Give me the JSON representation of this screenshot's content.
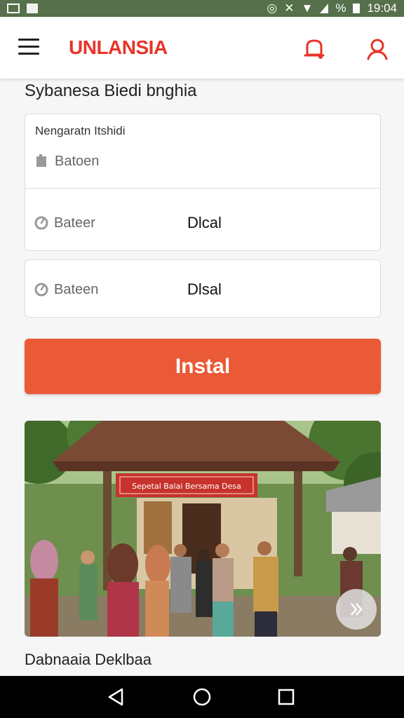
{
  "status_bar": {
    "time": "19:04",
    "battery_label": "%",
    "icons": [
      "image-icon",
      "alarm-icon",
      "vibrate-icon",
      "no-signal-icon",
      "wifi-icon",
      "signal-icon",
      "battery-icon"
    ]
  },
  "header": {
    "logo_text": "UNLANSIA",
    "accent_color": "#e8342a",
    "icons": [
      "menu-icon",
      "notification-bell-icon",
      "user-icon"
    ]
  },
  "page": {
    "title": "Sybanesa Biedi bnghia"
  },
  "form": {
    "field1": {
      "label": "Nengaratn Itshidi",
      "placeholder": "Batoen",
      "icon": "document-icon"
    },
    "field2": {
      "label": "Bateer",
      "value": "Dlcal",
      "icon": "clock-icon"
    },
    "field3": {
      "label": "Bateen",
      "value": "Dlsal",
      "icon": "clock-icon"
    }
  },
  "install_button": {
    "label": "Instal",
    "color": "#ea5a36"
  },
  "photo": {
    "banner_text": "Sepetal Balai Bersama Desa",
    "next_icon": "chevron-right-icon"
  },
  "footer_caption": "Dabnaaia Deklbaa",
  "nav_bar": {
    "icons": [
      "back-icon",
      "home-icon",
      "recents-icon"
    ]
  }
}
